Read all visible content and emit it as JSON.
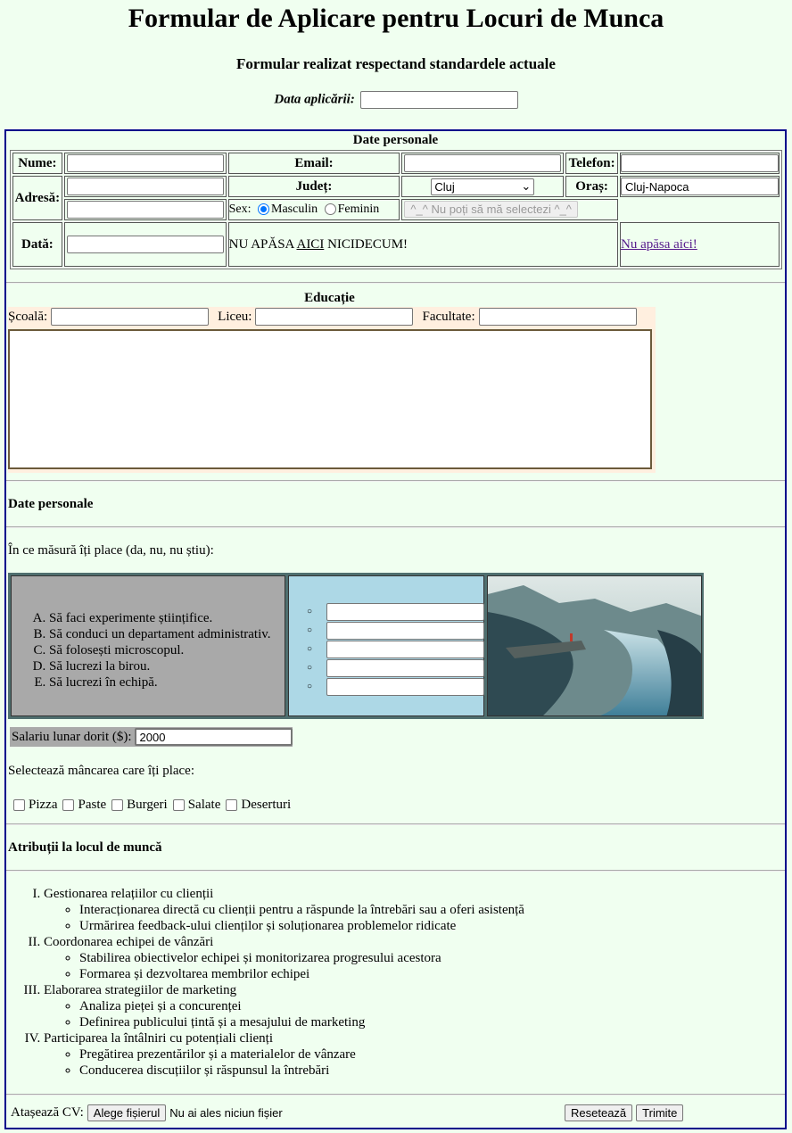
{
  "header": {
    "title": "Formular de Aplicare pentru Locuri de Munca",
    "subtitle": "Formular realizat respectand standardele actuale",
    "app_date_label": "Data aplicării:"
  },
  "personal": {
    "caption": "Date personale",
    "name_label": "Nume:",
    "email_label": "Email:",
    "phone_label": "Telefon:",
    "address_label": "Adresă:",
    "county_label": "Județ:",
    "county_value": "Cluj",
    "city_label": "Oraș:",
    "city_value": "Cluj-Napoca",
    "sex_label": "Sex:",
    "sex_male": "Masculin",
    "sex_female": "Feminin",
    "disabled_button": "^_^ Nu poți să mă selectezi ^_^",
    "date_label": "Dată:",
    "no_press_prefix": "NU APĂSA ",
    "no_press_link": "AICI",
    "no_press_suffix": " NICIDECUM!",
    "no_press_link2": "Nu apăsa aici!"
  },
  "education": {
    "caption": "Educație",
    "school_label": "Școală:",
    "highschool_label": "Liceu:",
    "faculty_label": "Facultate:"
  },
  "section2": {
    "heading": "Date personale",
    "question": "În ce măsură îți place (da, nu, nu știu):",
    "items": [
      "Să faci experimente științifice.",
      "Să conduci un departament administrativ.",
      "Să folosești microscopul.",
      "Să lucrezi la birou.",
      "Să lucrezi în echipă."
    ],
    "salary_label": "Salariu lunar dorit ($):",
    "salary_value": "2000",
    "food_question": "Selectează mâncarea care îți place:",
    "foods": [
      "Pizza",
      "Paste",
      "Burgeri",
      "Salate",
      "Deserturi"
    ]
  },
  "duties": {
    "heading": "Atribuții la locul de muncă",
    "items": [
      {
        "title": "Gestionarea relațiilor cu clienții",
        "subs": [
          "Interacționarea directă cu clienții pentru a răspunde la întrebări sau a oferi asistență",
          "Urmărirea feedback-ului clienților și soluționarea problemelor ridicate"
        ]
      },
      {
        "title": "Coordonarea echipei de vânzări",
        "subs": [
          "Stabilirea obiectivelor echipei și monitorizarea progresului acestora",
          "Formarea și dezvoltarea membrilor echipei"
        ]
      },
      {
        "title": "Elaborarea strategiilor de marketing",
        "subs": [
          "Analiza pieței și a concurenței",
          "Definirea publicului țintă și a mesajului de marketing"
        ]
      },
      {
        "title": "Participarea la întâlniri cu potențiali clienți",
        "subs": [
          "Pregătirea prezentărilor și a materialelor de vânzare",
          "Conducerea discuțiilor și răspunsul la întrebări"
        ]
      }
    ]
  },
  "footer": {
    "cv_label": "Atașează CV:",
    "choose_file": "Alege fișierul",
    "no_file": "Nu ai ales niciun fișier",
    "reset": "Resetează",
    "submit": "Trimite"
  }
}
